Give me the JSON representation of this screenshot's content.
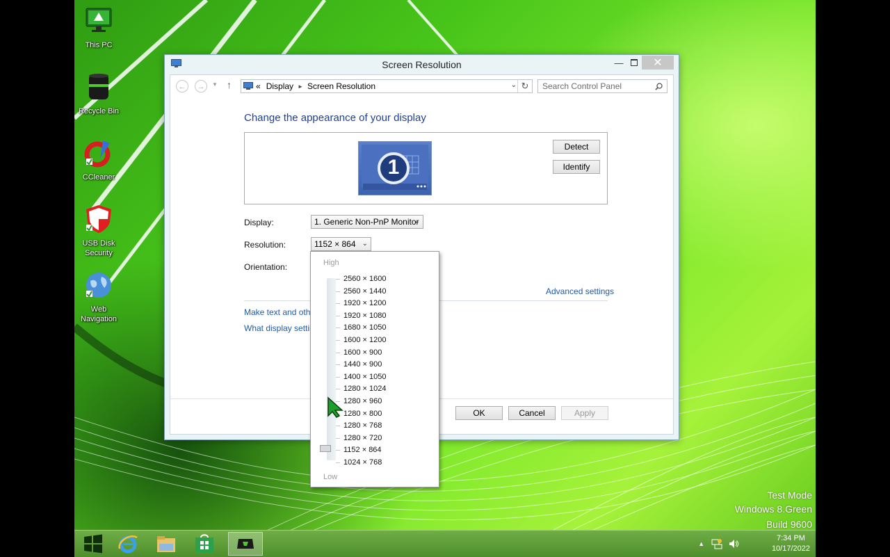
{
  "desktop": {
    "icons": [
      {
        "label": "This PC"
      },
      {
        "label": "Recycle Bin"
      },
      {
        "label": "CCleaner"
      },
      {
        "label": "USB Disk Security"
      },
      {
        "label": "Web Navigation"
      }
    ],
    "watermark": {
      "line1": "Test Mode",
      "line2": "Windows 8.Green",
      "line3": "Build 9600"
    }
  },
  "window": {
    "title": "Screen Resolution",
    "breadcrumb": {
      "prefix": "«",
      "item1": "Display",
      "item2": "Screen Resolution"
    },
    "search_placeholder": "Search Control Panel",
    "heading": "Change the appearance of your display",
    "monitor_number": "1",
    "detect_label": "Detect",
    "identify_label": "Identify",
    "display_label": "Display:",
    "display_value": "1. Generic Non-PnP Monitor",
    "resolution_label": "Resolution:",
    "resolution_value": "1152 × 864",
    "orientation_label": "Orientation:",
    "advanced_link": "Advanced settings",
    "link_text_size": "Make text and other",
    "link_display_settings": "What display setting",
    "ok_label": "OK",
    "cancel_label": "Cancel",
    "apply_label": "Apply"
  },
  "resolution_menu": {
    "high_label": "High",
    "low_label": "Low",
    "options": [
      "2560 × 1600",
      "2560 × 1440",
      "1920 × 1200",
      "1920 × 1080",
      "1680 × 1050",
      "1600 × 1200",
      "1600 × 900",
      "1440 × 900",
      "1400 × 1050",
      "1280 × 1024",
      "1280 × 960",
      "1280 × 800",
      "1280 × 768",
      "1280 × 720",
      "1152 × 864",
      "1024 × 768"
    ],
    "selected": "1152 × 864"
  },
  "taskbar": {
    "apps": [
      "start",
      "internet-explorer",
      "file-explorer",
      "store",
      "display-settings"
    ],
    "clock_time": "7:34 PM",
    "clock_date": "10/17/2022"
  },
  "colors": {
    "accent": "#1e3f8f",
    "link": "#1e5aa8",
    "taskbar": "#5f9e38"
  }
}
